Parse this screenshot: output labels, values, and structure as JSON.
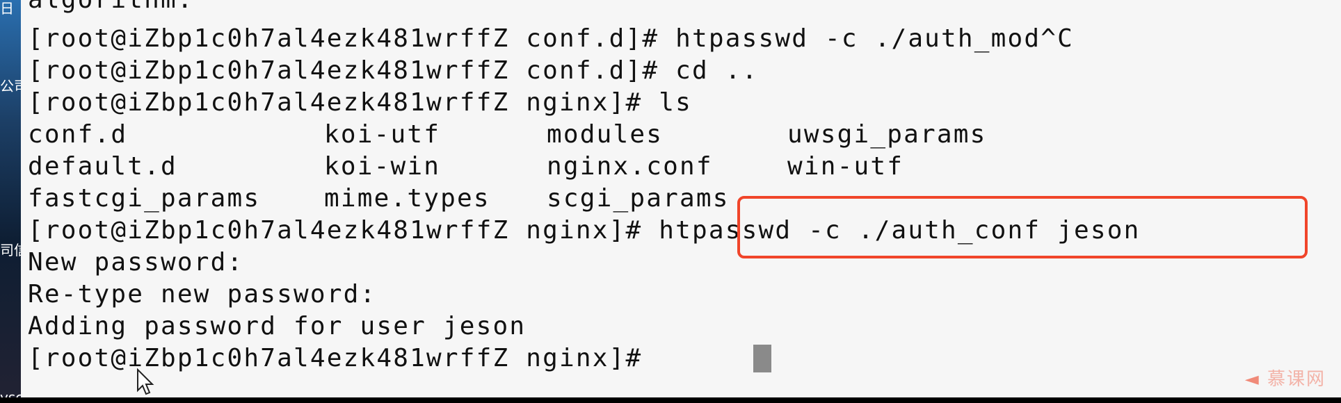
{
  "terminal": {
    "lines": {
      "l0": "algorithm.",
      "l1": "[root@iZbp1c0h7al4ezk481wrffZ conf.d]# htpasswd -c ./auth_mod^C",
      "l2": "[root@iZbp1c0h7al4ezk481wrffZ conf.d]# cd ..",
      "l3": "[root@iZbp1c0h7al4ezk481wrffZ nginx]# ls",
      "l7": "[root@iZbp1c0h7al4ezk481wrffZ nginx]# htpasswd -c ./auth_conf jeson",
      "l8": "New password:",
      "l9": "Re-type new password:",
      "l10": "Adding password for user jeson",
      "l11": "[root@iZbp1c0h7al4ezk481wrffZ nginx]# "
    },
    "ls_output": {
      "row1": [
        "conf.d",
        "koi-utf",
        "modules",
        "uwsgi_params"
      ],
      "row2": [
        "default.d",
        "koi-win",
        "nginx.conf",
        "win-utf"
      ],
      "row3": [
        "fastcgi_params",
        "mime.types",
        "scgi_params",
        ""
      ]
    },
    "colors": {
      "directory": "#2d4fd6",
      "special_dir": "#2ecfd6",
      "highlight_border": "#f0452a"
    }
  },
  "background_window": {
    "fragments": [
      "日",
      "公司",
      "司信",
      "ysc"
    ]
  },
  "watermark": "慕课网",
  "icons": {
    "cursor": "mouse-pointer-icon",
    "logo": "imooc-flame-icon"
  }
}
